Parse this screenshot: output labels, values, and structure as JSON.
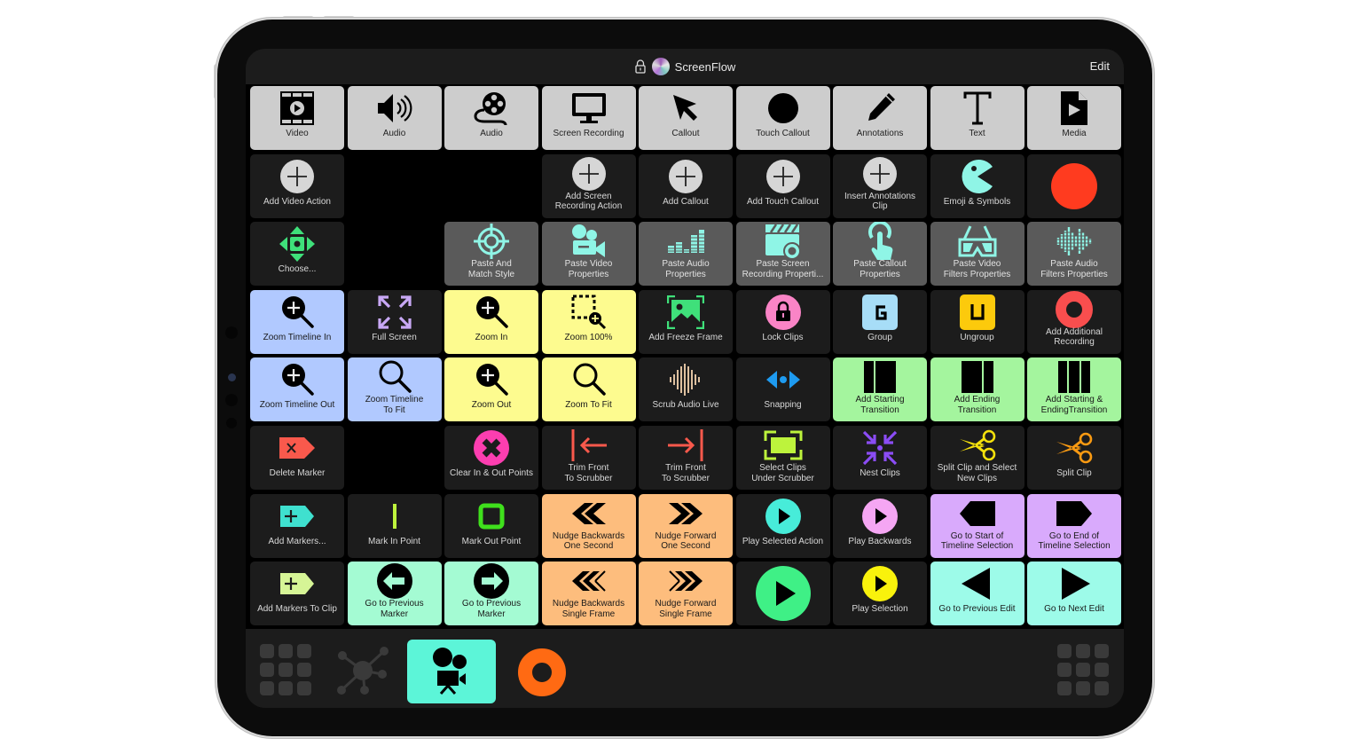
{
  "titlebar": {
    "app_name": "ScreenFlow",
    "edit_label": "Edit",
    "lock_icon": "lock-icon",
    "app_icon": "screenflow-app-icon"
  },
  "colors": {
    "gray": "#cdcdcd",
    "dark": "#1c1c1c",
    "mid": "#5a5a5a",
    "blue": "#b1c9ff",
    "yellow": "#fdfb8f",
    "green": "#a4f59e",
    "orange": "#fdbd7d",
    "mint": "#a4fbd3",
    "purple": "#d9aafc",
    "aqua": "#9dfbe9",
    "record_red": "#ff3b1f",
    "active_tab": "#5cf5d8",
    "record_tab": "#ff6a13"
  },
  "buttons": [
    {
      "label": "Video",
      "icon": "video-film-icon",
      "row": 0,
      "col": 0,
      "style": "gray"
    },
    {
      "label": "Audio",
      "icon": "speaker-icon",
      "row": 0,
      "col": 1,
      "style": "gray"
    },
    {
      "label": "Audio",
      "icon": "film-reel-icon",
      "row": 0,
      "col": 2,
      "style": "gray"
    },
    {
      "label": "Screen Recording",
      "icon": "monitor-icon",
      "row": 0,
      "col": 3,
      "style": "gray"
    },
    {
      "label": "Callout",
      "icon": "cursor-arrow-icon",
      "row": 0,
      "col": 4,
      "style": "gray"
    },
    {
      "label": "Touch Callout",
      "icon": "filled-circle-icon",
      "row": 0,
      "col": 5,
      "style": "gray"
    },
    {
      "label": "Annotations",
      "icon": "pencil-icon",
      "row": 0,
      "col": 6,
      "style": "gray"
    },
    {
      "label": "Text",
      "icon": "text-t-icon",
      "row": 0,
      "col": 7,
      "style": "gray"
    },
    {
      "label": "Media",
      "icon": "media-file-icon",
      "row": 0,
      "col": 8,
      "style": "gray"
    },
    {
      "label": "Add Video Action",
      "icon": "plus-circle-icon",
      "row": 1,
      "col": 0,
      "style": "dark"
    },
    {
      "label": "Add Screen\nRecording Action",
      "icon": "plus-circle-icon",
      "row": 1,
      "col": 3,
      "style": "dark"
    },
    {
      "label": "Add Callout",
      "icon": "plus-circle-icon",
      "row": 1,
      "col": 4,
      "style": "dark"
    },
    {
      "label": "Add Touch Callout",
      "icon": "plus-circle-icon",
      "row": 1,
      "col": 5,
      "style": "dark"
    },
    {
      "label": "Insert Annotations\nClip",
      "icon": "plus-circle-icon",
      "row": 1,
      "col": 6,
      "style": "dark"
    },
    {
      "label": "Emoji & Symbols",
      "icon": "pacman-icon",
      "row": 1,
      "col": 7,
      "style": "dark"
    },
    {
      "label": "",
      "icon": "record-circle-icon",
      "row": 1,
      "col": 8,
      "style": "dark"
    },
    {
      "label": "Choose...",
      "icon": "move-arrows-icon",
      "row": 2,
      "col": 0,
      "style": "dark"
    },
    {
      "label": "Paste And\nMatch Style",
      "icon": "target-crosshair-icon",
      "row": 2,
      "col": 2,
      "style": "mid"
    },
    {
      "label": "Paste Video\nProperties",
      "icon": "movie-camera-icon",
      "row": 2,
      "col": 3,
      "style": "mid"
    },
    {
      "label": "Paste Audio\nProperties",
      "icon": "audio-levels-icon",
      "row": 2,
      "col": 4,
      "style": "mid"
    },
    {
      "label": "Paste Screen\nRecording Properti...",
      "icon": "clapper-icon",
      "row": 2,
      "col": 5,
      "style": "mid"
    },
    {
      "label": "Paste Callout\nProperties",
      "icon": "touch-finger-icon",
      "row": 2,
      "col": 6,
      "style": "mid"
    },
    {
      "label": "Paste Video\nFilters Properties",
      "icon": "3d-glasses-icon",
      "row": 2,
      "col": 7,
      "style": "mid"
    },
    {
      "label": "Paste Audio\nFilters Properties",
      "icon": "audio-wave-icon",
      "row": 2,
      "col": 8,
      "style": "mid"
    },
    {
      "label": "Zoom Timeline In",
      "icon": "zoom-in-filled-icon",
      "row": 3,
      "col": 0,
      "style": "blue"
    },
    {
      "label": "Full Screen",
      "icon": "expand-arrows-icon",
      "row": 3,
      "col": 1,
      "style": "dark"
    },
    {
      "label": "Zoom In",
      "icon": "zoom-in-filled-icon",
      "row": 3,
      "col": 2,
      "style": "yellow"
    },
    {
      "label": "Zoom 100%",
      "icon": "zoom-selection-icon",
      "row": 3,
      "col": 3,
      "style": "yellow"
    },
    {
      "label": "Add Freeze Frame",
      "icon": "image-frame-icon",
      "row": 3,
      "col": 4,
      "style": "dark"
    },
    {
      "label": "Lock Clips",
      "icon": "lock-circle-icon",
      "row": 3,
      "col": 5,
      "style": "dark"
    },
    {
      "label": "Group",
      "icon": "group-g-icon",
      "row": 3,
      "col": 6,
      "style": "dark"
    },
    {
      "label": "Ungroup",
      "icon": "ungroup-u-icon",
      "row": 3,
      "col": 7,
      "style": "dark"
    },
    {
      "label": "Add Additional\nRecording",
      "icon": "record-ring-icon",
      "row": 3,
      "col": 8,
      "style": "dark"
    },
    {
      "label": "Zoom Timeline Out",
      "icon": "zoom-in-filled-icon",
      "row": 4,
      "col": 0,
      "style": "blue"
    },
    {
      "label": "Zoom Timeline\nTo Fit",
      "icon": "magnifier-icon",
      "row": 4,
      "col": 1,
      "style": "blue"
    },
    {
      "label": "Zoom Out",
      "icon": "zoom-in-filled-icon",
      "row": 4,
      "col": 2,
      "style": "yellow"
    },
    {
      "label": "Zoom To Fit",
      "icon": "magnifier-icon",
      "row": 4,
      "col": 3,
      "style": "yellow"
    },
    {
      "label": "Scrub Audio Live",
      "icon": "sound-bars-icon",
      "row": 4,
      "col": 4,
      "style": "dark"
    },
    {
      "label": "Snapping",
      "icon": "snapping-icon",
      "row": 4,
      "col": 5,
      "style": "dark"
    },
    {
      "label": "Add Starting\nTransition",
      "icon": "starting-transition-icon",
      "row": 4,
      "col": 6,
      "style": "green"
    },
    {
      "label": "Add Ending\nTransition",
      "icon": "ending-transition-icon",
      "row": 4,
      "col": 7,
      "style": "green"
    },
    {
      "label": "Add Starting &\nEndingTransition",
      "icon": "both-transitions-icon",
      "row": 4,
      "col": 8,
      "style": "green"
    },
    {
      "label": "Delete Marker",
      "icon": "delete-marker-icon",
      "row": 5,
      "col": 0,
      "style": "dark"
    },
    {
      "label": "Clear In & Out Points",
      "icon": "clear-x-circle-icon",
      "row": 5,
      "col": 2,
      "style": "dark"
    },
    {
      "label": "Trim Front\nTo Scrubber",
      "icon": "trim-front-icon",
      "row": 5,
      "col": 3,
      "style": "dark"
    },
    {
      "label": "Trim Front\nTo Scrubber",
      "icon": "trim-end-icon",
      "row": 5,
      "col": 4,
      "style": "dark"
    },
    {
      "label": "Select Clips\nUnder Scrubber",
      "icon": "select-clips-icon",
      "row": 5,
      "col": 5,
      "style": "dark"
    },
    {
      "label": "Nest Clips",
      "icon": "nest-arrows-icon",
      "row": 5,
      "col": 6,
      "style": "dark"
    },
    {
      "label": "Split Clip and Select\nNew Clips",
      "icon": "scissors-yellow-icon",
      "row": 5,
      "col": 7,
      "style": "dark"
    },
    {
      "label": "Split Clip",
      "icon": "scissors-orange-icon",
      "row": 5,
      "col": 8,
      "style": "dark"
    },
    {
      "label": "Add Markers...",
      "icon": "add-marker-icon",
      "row": 6,
      "col": 0,
      "style": "dark"
    },
    {
      "label": "Mark In Point",
      "icon": "mark-in-icon",
      "row": 6,
      "col": 1,
      "style": "dark"
    },
    {
      "label": "Mark Out Point",
      "icon": "mark-out-icon",
      "row": 6,
      "col": 2,
      "style": "dark"
    },
    {
      "label": "Nudge Backwards\nOne Second",
      "icon": "double-chevron-left-icon",
      "row": 6,
      "col": 3,
      "style": "orange"
    },
    {
      "label": "Nudge Forward\nOne Second",
      "icon": "double-chevron-right-icon",
      "row": 6,
      "col": 4,
      "style": "orange"
    },
    {
      "label": "Play Selected Action",
      "icon": "play-circle-teal-icon",
      "row": 6,
      "col": 5,
      "style": "dark"
    },
    {
      "label": "Play Backwards",
      "icon": "play-circle-pink-icon",
      "row": 6,
      "col": 6,
      "style": "dark"
    },
    {
      "label": "Go to Start of\nTimeline Selection",
      "icon": "go-start-icon",
      "row": 6,
      "col": 7,
      "style": "purple"
    },
    {
      "label": "Go to End of\nTimeline Selection",
      "icon": "go-end-icon",
      "row": 6,
      "col": 8,
      "style": "purple"
    },
    {
      "label": "Add Markers To Clip",
      "icon": "add-marker-clip-icon",
      "row": 7,
      "col": 0,
      "style": "dark"
    },
    {
      "label": "Go to Previous\nMarker",
      "icon": "arrow-left-circle-icon",
      "row": 7,
      "col": 1,
      "style": "mint"
    },
    {
      "label": "Go to Previous\nMarker",
      "icon": "arrow-right-circle-icon",
      "row": 7,
      "col": 2,
      "style": "mint"
    },
    {
      "label": "Nudge Backwards\nSingle Frame",
      "icon": "triple-chevron-left-icon",
      "row": 7,
      "col": 3,
      "style": "orange"
    },
    {
      "label": "Nudge Forward\nSingle Frame",
      "icon": "triple-chevron-right-icon",
      "row": 7,
      "col": 4,
      "style": "orange"
    },
    {
      "label": "",
      "icon": "play-circle-large-icon",
      "row": 7,
      "col": 5,
      "style": "dark"
    },
    {
      "label": "Play Selection",
      "icon": "play-circle-yellow-icon",
      "row": 7,
      "col": 6,
      "style": "dark"
    },
    {
      "label": "Go to Previous Edit",
      "icon": "triangle-left-icon",
      "row": 7,
      "col": 7,
      "style": "aqua"
    },
    {
      "label": "Go to Next Edit",
      "icon": "triangle-right-icon",
      "row": 7,
      "col": 8,
      "style": "aqua"
    }
  ],
  "bottom_tabs": [
    {
      "name": "grid-apps-tab",
      "icon": "grid-icon",
      "active": false
    },
    {
      "name": "network-tab",
      "icon": "network-hub-icon",
      "active": false
    },
    {
      "name": "screenflow-tab",
      "icon": "movie-camera-icon",
      "active": true
    },
    {
      "name": "record-tab",
      "icon": "record-ring-icon",
      "active": false
    },
    {
      "name": "grid-apps-right-tab",
      "icon": "grid-icon",
      "active": false
    }
  ]
}
